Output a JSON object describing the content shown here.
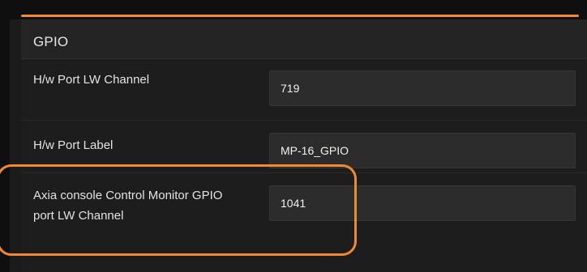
{
  "section": {
    "title": "GPIO"
  },
  "fields": [
    {
      "label": "H/w Port LW Channel",
      "value": "719"
    },
    {
      "label": "H/w Port Label",
      "value": "MP-16_GPIO"
    },
    {
      "label": "Axia console Control Monitor GPIO port LW Channel",
      "value": "1041"
    }
  ],
  "colors": {
    "accent": "#ef8a33",
    "panel": "#1b1b1b",
    "input": "#2c2c2c"
  }
}
